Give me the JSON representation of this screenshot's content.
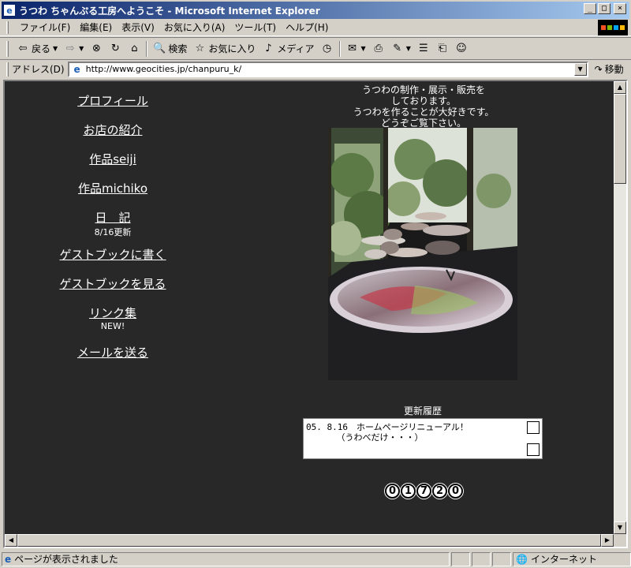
{
  "window": {
    "title": "うつわ ちゃんぷる工房へようこそ - Microsoft Internet Explorer",
    "minimize_glyph": "_",
    "maximize_glyph": "□",
    "close_glyph": "×"
  },
  "menu": [
    "ファイル(F)",
    "編集(E)",
    "表示(V)",
    "お気に入り(A)",
    "ツール(T)",
    "ヘルプ(H)"
  ],
  "toolbar": {
    "back_label": "戻る",
    "search_label": "検索",
    "favorites_label": "お気に入り",
    "media_label": "メディア"
  },
  "address": {
    "label": "アドレス(D)",
    "url": "http://www.geocities.jp/chanpuru_k/",
    "go_label": "移動"
  },
  "page": {
    "nav": [
      {
        "label": "プロフィール"
      },
      {
        "label": "お店の紹介"
      },
      {
        "label": "作品seiji"
      },
      {
        "label": "作品michiko"
      },
      {
        "label": "日　記",
        "sub": "8/16更新"
      },
      {
        "label": "ゲストブックに書く"
      },
      {
        "label": "ゲストブックを見る"
      },
      {
        "label": "リンク集",
        "sub": "NEW!"
      },
      {
        "label": "メールを送る"
      }
    ],
    "intro_lines": [
      "うつわの制作・展示・販売を",
      "しております。",
      "うつわを作ることが大好きです。",
      "どうぞご覧下さい。"
    ],
    "history_title": "更新履歴",
    "history_text": "05. 8.16　ホームページリニューアル！\n　　　　（うわべだけ・・・）",
    "counter_digits": [
      "0",
      "1",
      "7",
      "2",
      "0"
    ]
  },
  "status": {
    "text": "ページが表示されました",
    "zone": "インターネット"
  }
}
